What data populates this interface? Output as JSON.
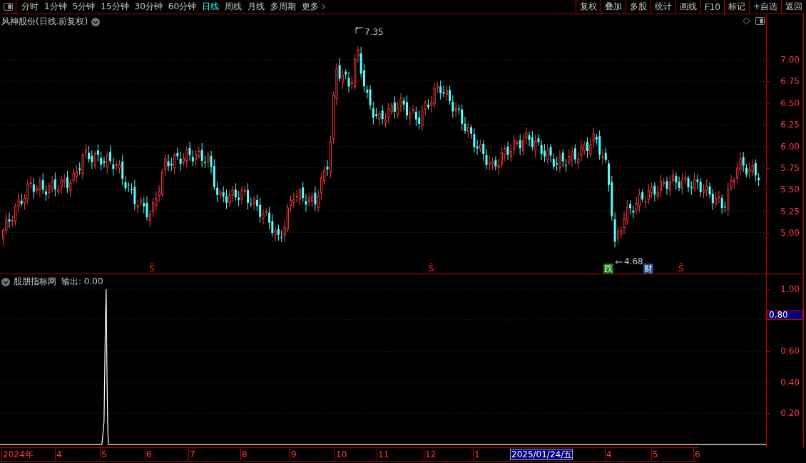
{
  "toolbar": {
    "tabs": [
      {
        "label": "分时",
        "selected": false
      },
      {
        "label": "1分钟",
        "selected": false
      },
      {
        "label": "5分钟",
        "selected": false
      },
      {
        "label": "15分钟",
        "selected": false
      },
      {
        "label": "30分钟",
        "selected": false
      },
      {
        "label": "60分钟",
        "selected": false
      },
      {
        "label": "日线",
        "selected": true
      },
      {
        "label": "周线",
        "selected": false
      },
      {
        "label": "月线",
        "selected": false
      },
      {
        "label": "多周期",
        "selected": false
      },
      {
        "label": "更多",
        "selected": false
      }
    ],
    "buttons": [
      "复权",
      "叠加",
      "多股",
      "统计",
      "画线",
      "F10",
      "标记",
      "+自选",
      "返回"
    ]
  },
  "main_panel": {
    "title": "风神股份(日线.前复权)",
    "y_ticks": [
      "7.00",
      "6.75",
      "6.50",
      "6.25",
      "6.00",
      "5.75",
      "5.50",
      "5.25",
      "5.00"
    ],
    "high_label": "7.35",
    "low_label": "4.68",
    "markers": [
      {
        "kind": "signal",
        "text": "Ŝ"
      },
      {
        "kind": "signal",
        "text": "Ŝ"
      },
      {
        "kind": "fall",
        "text": "跌"
      },
      {
        "kind": "finance",
        "text": "财"
      },
      {
        "kind": "signal",
        "text": "Ŝ"
      }
    ]
  },
  "indicator_panel": {
    "name": "股朋指标网",
    "output": "输出: 0.00",
    "y_ticks": [
      "1.00",
      "0.60",
      "0.40",
      "0.20"
    ],
    "cursor_value": "0.80"
  },
  "date_axis": {
    "labels": [
      {
        "text": "2024年",
        "selected": false
      },
      {
        "text": "4",
        "selected": false
      },
      {
        "text": "5",
        "selected": false
      },
      {
        "text": "6",
        "selected": false
      },
      {
        "text": "7",
        "selected": false
      },
      {
        "text": "8",
        "selected": false
      },
      {
        "text": "9",
        "selected": false
      },
      {
        "text": "10",
        "selected": false
      },
      {
        "text": "11",
        "selected": false
      },
      {
        "text": "12",
        "selected": false
      },
      {
        "text": "1",
        "selected": false
      },
      {
        "text": "2025/01/24/五",
        "selected": true
      },
      {
        "text": "4",
        "selected": false
      },
      {
        "text": "5",
        "selected": false
      },
      {
        "text": "6",
        "selected": false
      }
    ]
  }
}
